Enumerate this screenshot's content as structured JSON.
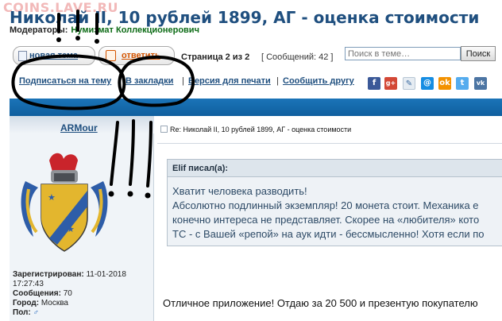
{
  "watermark": "COINS.LAVE.RU",
  "topic": {
    "title": "Николай II, 10 рублей 1899, АГ - оценка стоимости",
    "moderators_label": "Модераторы:",
    "moderator": "Нумизмат Коллекционерович"
  },
  "actions": {
    "new_topic": "новая тема",
    "reply": "ответить",
    "page_info": "Страница 2 из 2",
    "messages": "[ Сообщений: 42 ]"
  },
  "search": {
    "placeholder": "Поиск в теме…",
    "button": "Поиск"
  },
  "toolbar": {
    "subscribe": "Подписаться на тему",
    "bookmarks": "В закладки",
    "print": "Версия для печати",
    "tell_friend": "Сообщить другу",
    "separator": "|"
  },
  "social": [
    "facebook-icon",
    "google-plus-icon",
    "livejournal-icon",
    "mailru-icon",
    "odnoklassniki-icon",
    "twitter-icon",
    "vkontakte-icon"
  ],
  "colors": {
    "accent": "#1f4f7f",
    "moderator": "#0c6b15",
    "reply": "#d45400",
    "bar": "#1b74b8"
  },
  "post": {
    "author": "ARMour",
    "subject": "Re: Николай II, 10 рублей 1899, АГ - оценка стоимости",
    "registered_label": "Зарегистрирован:",
    "registered_date": "11-01-2018",
    "registered_time": "17:27:43",
    "messages_label": "Сообщения:",
    "messages_value": "70",
    "city_label": "Город:",
    "city_value": "Москва",
    "gender_label": "Пол:",
    "quote_author": "Elif писал(а):",
    "quote_lines": [
      "Хватит человека разводить!",
      "Абсолютно подлинный экземпляр! 20 монета стоит. Механика е",
      "конечно интереса не представляет. Скорее на «любителя» кото",
      "ТС - с Вашей «репой» на аук идти - бессмысленно! Хотя если по"
    ],
    "reply_text": "Отличное приложение! Отдаю за 20 500 и презентую покупателю"
  }
}
